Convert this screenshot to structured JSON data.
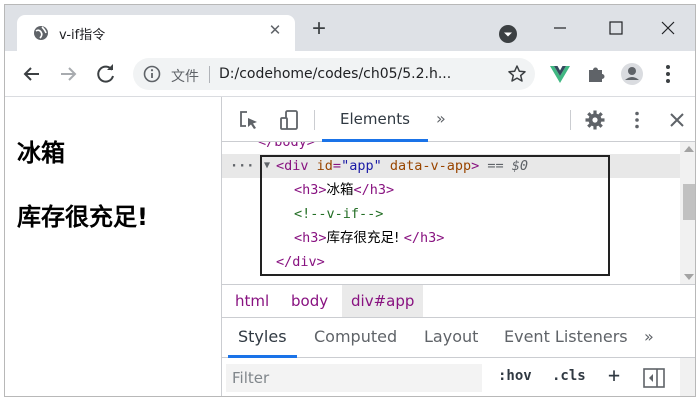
{
  "browser": {
    "tab_title": "v-if指令",
    "tab_close": "✕",
    "new_tab": "+",
    "omnibox_label": "文件",
    "url": "D:/codehome/codes/ch05/5.2.h..."
  },
  "page": {
    "heading1": "冰箱",
    "heading2": "库存很充足!"
  },
  "devtools": {
    "tab_elements": "Elements",
    "more_tabs": "»",
    "dom_lines": {
      "body_close_partial": "</body>",
      "div_open_tag": "<div",
      "div_id_attr": "id",
      "div_id_val": "\"app\"",
      "div_data_attr": "data-v-app",
      "div_gt": ">",
      "eq_marker": "== $0",
      "h3_1_open": "<h3>",
      "h3_1_text": "冰箱",
      "h3_1_close": "</h3>",
      "comment": "<!--v-if-->",
      "h3_2_open": "<h3>",
      "h3_2_text": "库存很充足! ",
      "h3_2_close": "</h3>",
      "div_close": "</div>"
    },
    "breadcrumbs": [
      "html",
      "body",
      "div#app"
    ],
    "subtabs": [
      "Styles",
      "Computed",
      "Layout",
      "Event Listeners",
      "»"
    ],
    "filter_placeholder": "Filter",
    "hov_label": ":hov",
    "cls_label": ".cls",
    "add_rule": "+"
  },
  "colors": {
    "accent": "#1a73e8",
    "tag": "#881280",
    "attr": "#994500",
    "attr_value": "#1a1aa6",
    "comment": "#236e25"
  }
}
